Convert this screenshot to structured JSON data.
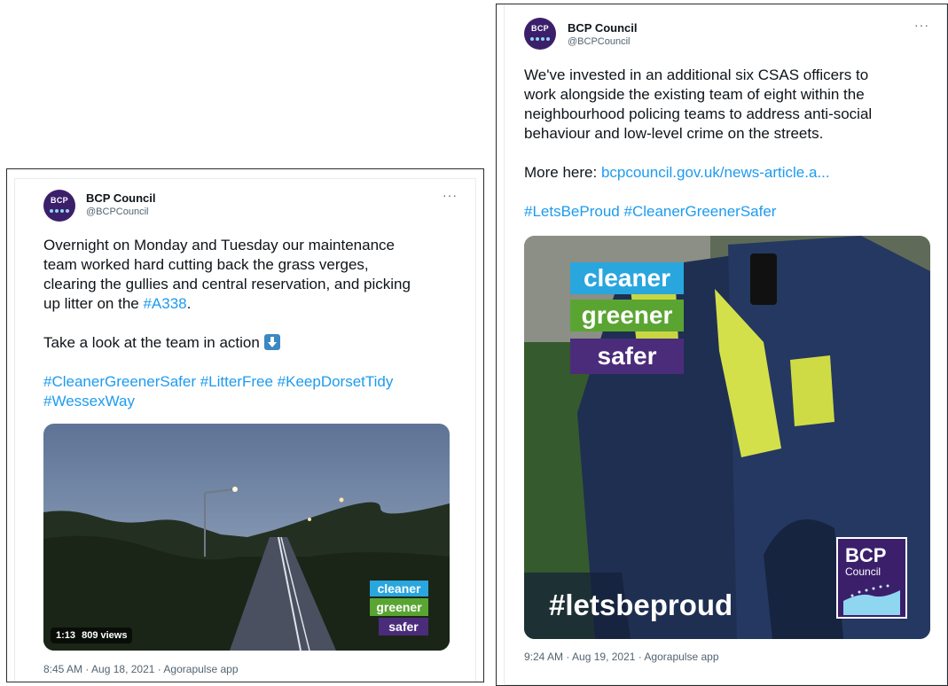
{
  "left_tweet": {
    "account_name": "BCP Council",
    "handle": "@BCPCouncil",
    "avatar_text": "BCP",
    "more_label": "···",
    "line1": "Overnight on Monday and Tuesday our maintenance",
    "line2": "team worked hard cutting back the grass verges,",
    "line3": "clearing the gullies and central reservation, and picking",
    "line4_prefix": "up litter on the ",
    "line4_link": "#A338",
    "line4_suffix": ".",
    "line5": "Take a look at the team in action",
    "arrow_icon": "down-arrow-emoji",
    "hashtags_line1": [
      "#CleanerGreenerSafer",
      "#LitterFree",
      "#KeepDorsetTidy"
    ],
    "hashtags_line2": [
      "#WessexWay"
    ],
    "video_duration": "1:13",
    "video_views": "809 views",
    "logo_words": [
      "cleaner",
      "greener",
      "safer"
    ],
    "timestamp": "8:45 AM · Aug 18, 2021 · Agorapulse app"
  },
  "right_tweet": {
    "account_name": "BCP Council",
    "handle": "@BCPCouncil",
    "avatar_text": "BCP",
    "more_label": "···",
    "line1": "We've invested in an additional six CSAS officers to",
    "line2": "work alongside the existing team of eight within the",
    "line3": "neighbourhood policing teams to address anti-social",
    "line4": "behaviour and low-level crime on the streets.",
    "more_prefix": "More here: ",
    "more_link": "bcpcouncil.gov.uk/news-article.a...",
    "hashtags": [
      "#LetsBeProud",
      "#CleanerGreenerSafer"
    ],
    "logo_words": [
      "cleaner",
      "greener",
      "safer"
    ],
    "campaign_tag": "#letsbeproud",
    "bcp_logo_title": "BCP",
    "bcp_logo_sub": "Council",
    "timestamp": "9:24 AM · Aug 19, 2021 · Agorapulse app"
  },
  "colors": {
    "link": "#1d9bf0",
    "brand_purple": "#3b1f6b",
    "cleaner_blue": "#2aa6de",
    "greener_green": "#5aa532",
    "safer_purple": "#4b2c7a"
  }
}
